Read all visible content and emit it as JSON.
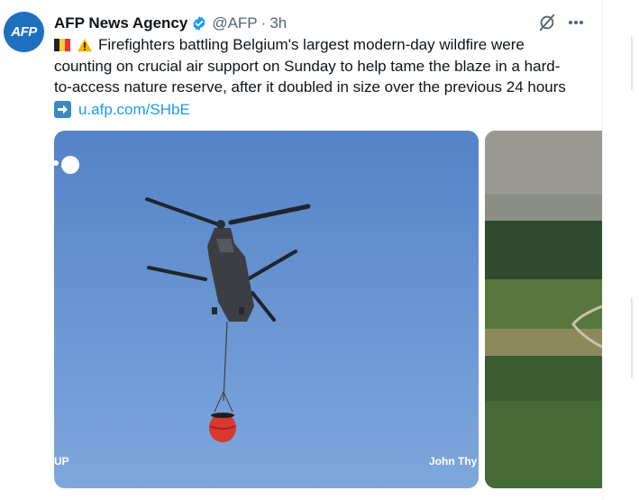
{
  "tweet": {
    "avatar_text": "AFP",
    "author_name": "AFP News Agency",
    "handle": "@AFP",
    "separator": "·",
    "time": "3h",
    "text_line1": "Firefighters battling Belgium's largest modern-day wildfire were",
    "text_line2": "counting on crucial air support on Sunday to help tame the blaze in a hard-",
    "text_line3": "to-access nature reserve, after it doubled in size over the previous 24 hours",
    "link": "u.afp.com/SHbE"
  },
  "media": {
    "photo1_credit_left": "UP",
    "photo1_credit_right": "John Thy"
  },
  "icons": {
    "flag": "belgium-flag-icon",
    "warning": "warning-icon",
    "arrow": "right-arrow-icon",
    "verified": "verified-badge-icon",
    "grok": "grok-icon",
    "more": "more-icon"
  },
  "colors": {
    "link": "#1d9bf0",
    "verified": "#1d9bf0",
    "avatar_bg": "#1f6fc1",
    "secondary_text": "#536471",
    "sky": "#5f8fd0"
  }
}
